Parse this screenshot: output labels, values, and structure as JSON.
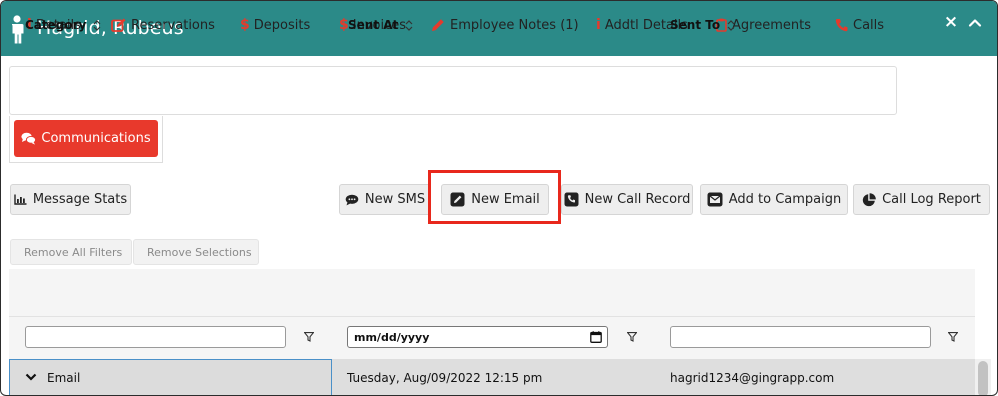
{
  "window": {
    "title": "Hagrid, Rubeus",
    "close_label": "×"
  },
  "tabs": [
    {
      "label": "Details",
      "icon": "info-icon"
    },
    {
      "label": "Reservations",
      "icon": "edit-square-icon"
    },
    {
      "label": "Deposits",
      "icon": "dollar-icon"
    },
    {
      "label": "Invoices",
      "icon": "dollar-icon"
    },
    {
      "label": "Employee Notes (1)",
      "icon": "pencil-icon"
    },
    {
      "label": "Addtl Details",
      "icon": "info-icon"
    },
    {
      "label": "Agreements",
      "icon": "clipboard-icon"
    },
    {
      "label": "Calls",
      "icon": "phone-icon"
    }
  ],
  "active_tab": {
    "label": "Communications",
    "icon": "comments-icon",
    "color": "#e8392c"
  },
  "toolbar": {
    "message_stats": "Message Stats",
    "new_sms": "New SMS",
    "new_email": "New Email",
    "new_call_record": "New Call Record",
    "add_to_campaign": "Add to Campaign",
    "call_log_report": "Call Log Report"
  },
  "filters": {
    "remove_all": "Remove All Filters",
    "remove_selections": "Remove Selections"
  },
  "grid": {
    "columns": [
      "Category",
      "Sent At",
      "Sent To"
    ],
    "date_placeholder": "mm/dd/yyyy",
    "rows": [
      {
        "category": "Email",
        "sent_at": "Tuesday, Aug/09/2022 12:15 pm",
        "sent_to": "hagrid1234@gingrapp.com"
      }
    ]
  },
  "colors": {
    "header": "#2b8a88",
    "accent_red": "#e8392c",
    "highlight": "#e8281c"
  }
}
